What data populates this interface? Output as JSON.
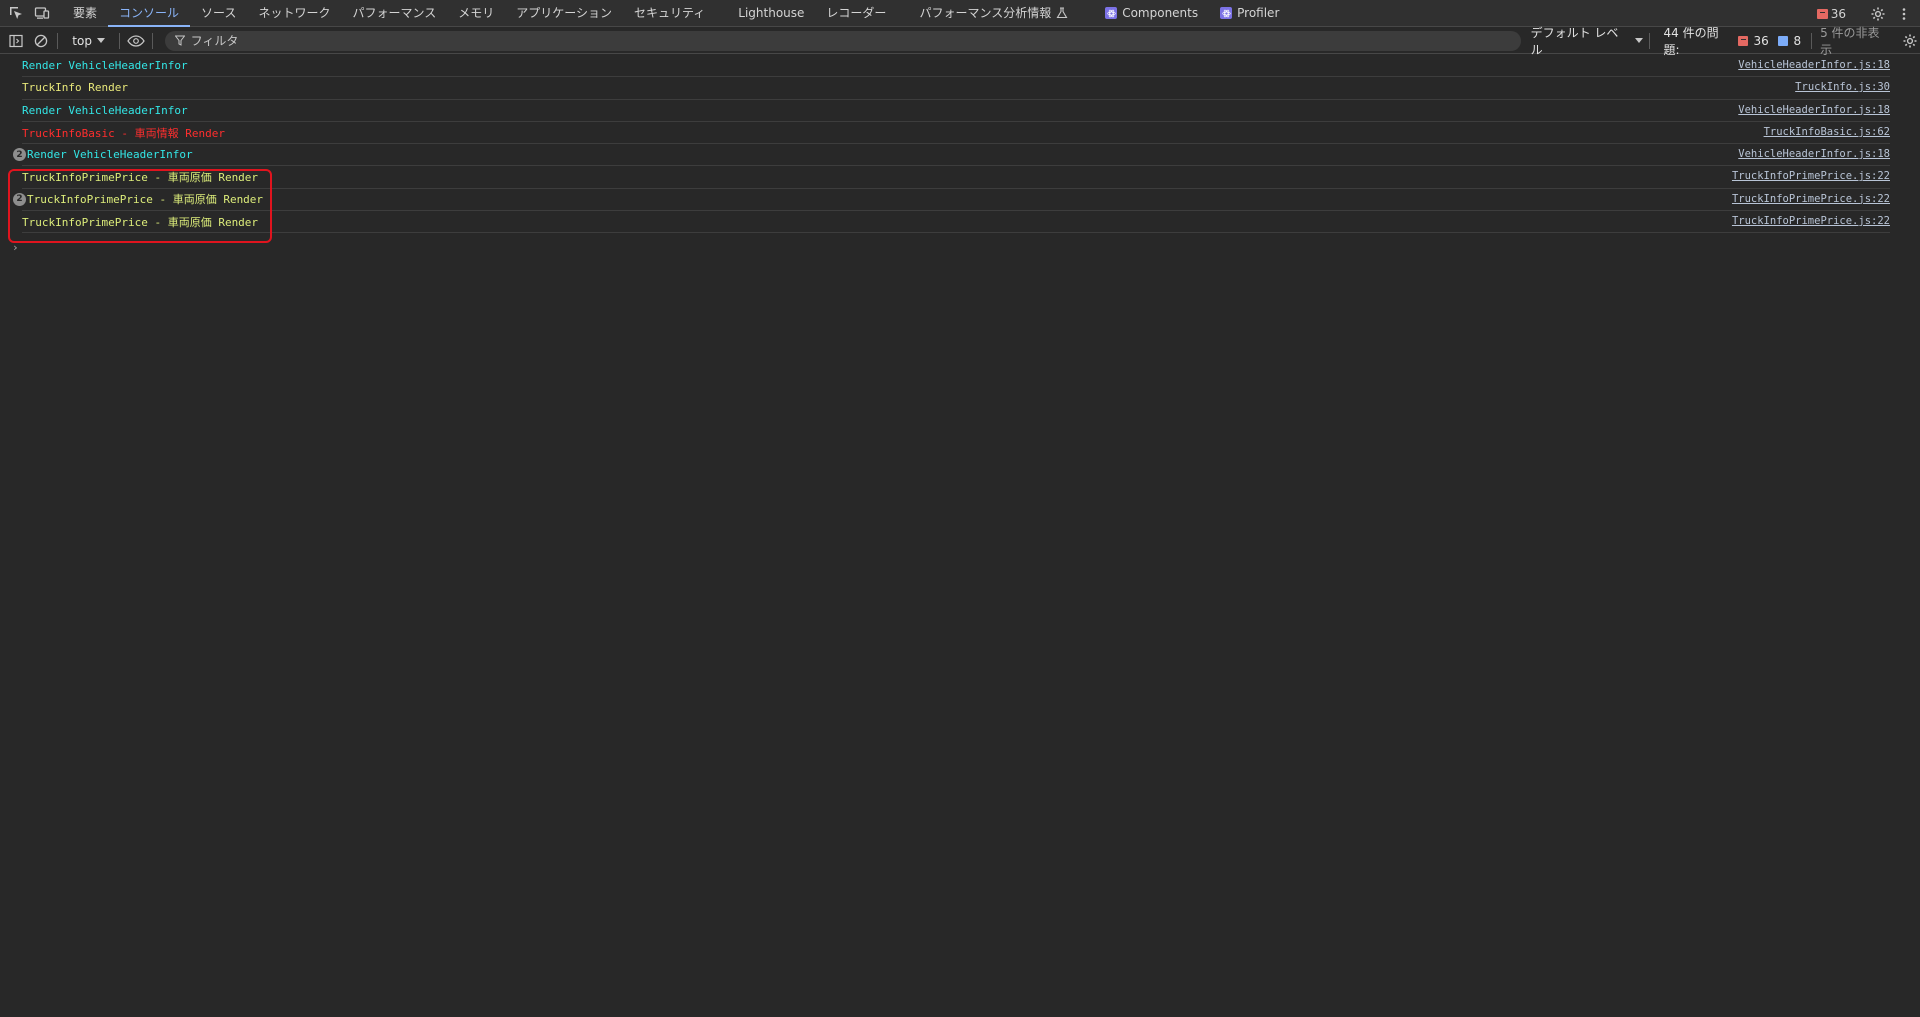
{
  "tabs": [
    {
      "label": "要素",
      "active": false
    },
    {
      "label": "コンソール",
      "active": true
    },
    {
      "label": "ソース",
      "active": false
    },
    {
      "label": "ネットワーク",
      "active": false
    },
    {
      "label": "パフォーマンス",
      "active": false
    },
    {
      "label": "メモリ",
      "active": false
    },
    {
      "label": "アプリケーション",
      "active": false
    },
    {
      "label": "セキュリティ",
      "active": false
    },
    {
      "label": "Lighthouse",
      "active": false
    },
    {
      "label": "レコーダー",
      "active": false
    },
    {
      "label": "パフォーマンス分析情報",
      "active": false
    },
    {
      "label": "Components",
      "active": false
    },
    {
      "label": "Profiler",
      "active": false
    }
  ],
  "tabbar": {
    "error_count": "36"
  },
  "toolbar": {
    "context": "top",
    "filter_placeholder": "フィルタ",
    "level": "デフォルト レベル",
    "issues_label": "44 件の問題:",
    "issues_errors": "36",
    "issues_info": "8",
    "hidden": "5 件の非表示"
  },
  "messages": [
    {
      "text": "Render VehicleHeaderInfor",
      "source": "VehicleHeaderInfor.js:18",
      "color": "#33e6e6",
      "repeat": ""
    },
    {
      "text": "TruckInfo Render",
      "source": "TruckInfo.js:30",
      "color": "#e8e87a",
      "repeat": ""
    },
    {
      "text": "Render VehicleHeaderInfor",
      "source": "VehicleHeaderInfor.js:18",
      "color": "#33e6e6",
      "repeat": ""
    },
    {
      "text": "TruckInfoBasic - 車両情報 Render",
      "source": "TruckInfoBasic.js:62",
      "color": "#ff2e2e",
      "repeat": ""
    },
    {
      "text": "Render VehicleHeaderInfor",
      "source": "VehicleHeaderInfor.js:18",
      "color": "#33e6e6",
      "repeat": "2"
    },
    {
      "text": "TruckInfoPrimePrice - 車両原価 Render",
      "source": "TruckInfoPrimePrice.js:22",
      "color": "#dcec7a",
      "repeat": ""
    },
    {
      "text": "TruckInfoPrimePrice - 車両原価 Render",
      "source": "TruckInfoPrimePrice.js:22",
      "color": "#dcec7a",
      "repeat": "2"
    },
    {
      "text": "TruckInfoPrimePrice - 車両原価 Render",
      "source": "TruckInfoPrimePrice.js:22",
      "color": "#dcec7a",
      "repeat": ""
    }
  ],
  "prompt": "›"
}
